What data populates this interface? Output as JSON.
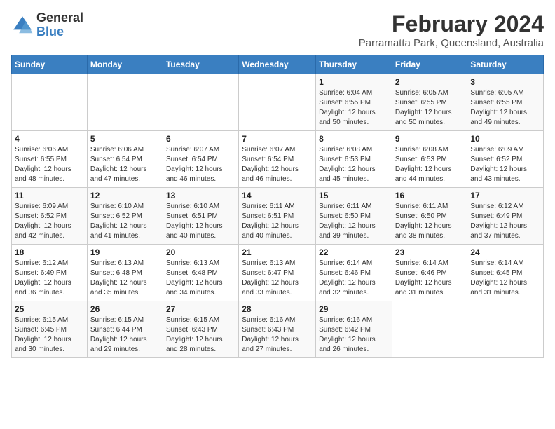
{
  "logo": {
    "general": "General",
    "blue": "Blue"
  },
  "header": {
    "month": "February 2024",
    "location": "Parramatta Park, Queensland, Australia"
  },
  "days_of_week": [
    "Sunday",
    "Monday",
    "Tuesday",
    "Wednesday",
    "Thursday",
    "Friday",
    "Saturday"
  ],
  "weeks": [
    [
      {
        "day": "",
        "info": ""
      },
      {
        "day": "",
        "info": ""
      },
      {
        "day": "",
        "info": ""
      },
      {
        "day": "",
        "info": ""
      },
      {
        "day": "1",
        "info": "Sunrise: 6:04 AM\nSunset: 6:55 PM\nDaylight: 12 hours\nand 50 minutes."
      },
      {
        "day": "2",
        "info": "Sunrise: 6:05 AM\nSunset: 6:55 PM\nDaylight: 12 hours\nand 50 minutes."
      },
      {
        "day": "3",
        "info": "Sunrise: 6:05 AM\nSunset: 6:55 PM\nDaylight: 12 hours\nand 49 minutes."
      }
    ],
    [
      {
        "day": "4",
        "info": "Sunrise: 6:06 AM\nSunset: 6:55 PM\nDaylight: 12 hours\nand 48 minutes."
      },
      {
        "day": "5",
        "info": "Sunrise: 6:06 AM\nSunset: 6:54 PM\nDaylight: 12 hours\nand 47 minutes."
      },
      {
        "day": "6",
        "info": "Sunrise: 6:07 AM\nSunset: 6:54 PM\nDaylight: 12 hours\nand 46 minutes."
      },
      {
        "day": "7",
        "info": "Sunrise: 6:07 AM\nSunset: 6:54 PM\nDaylight: 12 hours\nand 46 minutes."
      },
      {
        "day": "8",
        "info": "Sunrise: 6:08 AM\nSunset: 6:53 PM\nDaylight: 12 hours\nand 45 minutes."
      },
      {
        "day": "9",
        "info": "Sunrise: 6:08 AM\nSunset: 6:53 PM\nDaylight: 12 hours\nand 44 minutes."
      },
      {
        "day": "10",
        "info": "Sunrise: 6:09 AM\nSunset: 6:52 PM\nDaylight: 12 hours\nand 43 minutes."
      }
    ],
    [
      {
        "day": "11",
        "info": "Sunrise: 6:09 AM\nSunset: 6:52 PM\nDaylight: 12 hours\nand 42 minutes."
      },
      {
        "day": "12",
        "info": "Sunrise: 6:10 AM\nSunset: 6:52 PM\nDaylight: 12 hours\nand 41 minutes."
      },
      {
        "day": "13",
        "info": "Sunrise: 6:10 AM\nSunset: 6:51 PM\nDaylight: 12 hours\nand 40 minutes."
      },
      {
        "day": "14",
        "info": "Sunrise: 6:11 AM\nSunset: 6:51 PM\nDaylight: 12 hours\nand 40 minutes."
      },
      {
        "day": "15",
        "info": "Sunrise: 6:11 AM\nSunset: 6:50 PM\nDaylight: 12 hours\nand 39 minutes."
      },
      {
        "day": "16",
        "info": "Sunrise: 6:11 AM\nSunset: 6:50 PM\nDaylight: 12 hours\nand 38 minutes."
      },
      {
        "day": "17",
        "info": "Sunrise: 6:12 AM\nSunset: 6:49 PM\nDaylight: 12 hours\nand 37 minutes."
      }
    ],
    [
      {
        "day": "18",
        "info": "Sunrise: 6:12 AM\nSunset: 6:49 PM\nDaylight: 12 hours\nand 36 minutes."
      },
      {
        "day": "19",
        "info": "Sunrise: 6:13 AM\nSunset: 6:48 PM\nDaylight: 12 hours\nand 35 minutes."
      },
      {
        "day": "20",
        "info": "Sunrise: 6:13 AM\nSunset: 6:48 PM\nDaylight: 12 hours\nand 34 minutes."
      },
      {
        "day": "21",
        "info": "Sunrise: 6:13 AM\nSunset: 6:47 PM\nDaylight: 12 hours\nand 33 minutes."
      },
      {
        "day": "22",
        "info": "Sunrise: 6:14 AM\nSunset: 6:46 PM\nDaylight: 12 hours\nand 32 minutes."
      },
      {
        "day": "23",
        "info": "Sunrise: 6:14 AM\nSunset: 6:46 PM\nDaylight: 12 hours\nand 31 minutes."
      },
      {
        "day": "24",
        "info": "Sunrise: 6:14 AM\nSunset: 6:45 PM\nDaylight: 12 hours\nand 31 minutes."
      }
    ],
    [
      {
        "day": "25",
        "info": "Sunrise: 6:15 AM\nSunset: 6:45 PM\nDaylight: 12 hours\nand 30 minutes."
      },
      {
        "day": "26",
        "info": "Sunrise: 6:15 AM\nSunset: 6:44 PM\nDaylight: 12 hours\nand 29 minutes."
      },
      {
        "day": "27",
        "info": "Sunrise: 6:15 AM\nSunset: 6:43 PM\nDaylight: 12 hours\nand 28 minutes."
      },
      {
        "day": "28",
        "info": "Sunrise: 6:16 AM\nSunset: 6:43 PM\nDaylight: 12 hours\nand 27 minutes."
      },
      {
        "day": "29",
        "info": "Sunrise: 6:16 AM\nSunset: 6:42 PM\nDaylight: 12 hours\nand 26 minutes."
      },
      {
        "day": "",
        "info": ""
      },
      {
        "day": "",
        "info": ""
      }
    ]
  ]
}
